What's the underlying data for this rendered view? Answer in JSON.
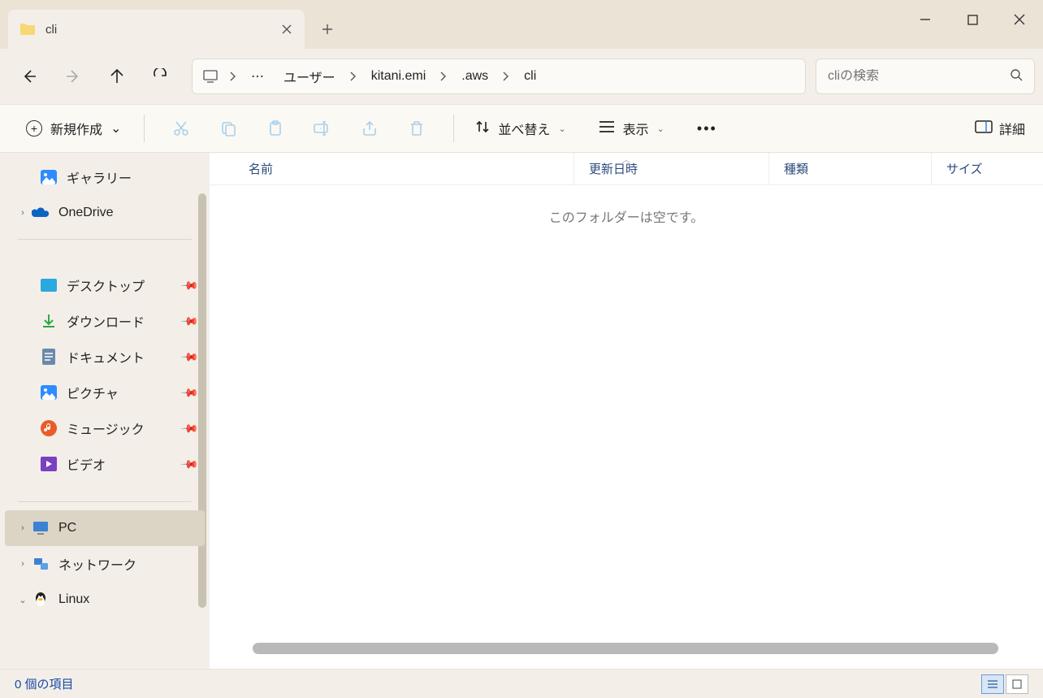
{
  "tab": {
    "title": "cli"
  },
  "breadcrumb": {
    "segments": [
      "ユーザー",
      "kitani.emi",
      ".aws",
      "cli"
    ]
  },
  "search": {
    "placeholder": "cliの検索"
  },
  "toolbar": {
    "new_label": "新規作成",
    "sort_label": "並べ替え",
    "view_label": "表示",
    "details_label": "詳細"
  },
  "sidebar": {
    "gallery": "ギャラリー",
    "onedrive": "OneDrive",
    "desktop": "デスクトップ",
    "downloads": "ダウンロード",
    "documents": "ドキュメント",
    "pictures": "ピクチャ",
    "music": "ミュージック",
    "videos": "ビデオ",
    "pc": "PC",
    "network": "ネットワーク",
    "linux": "Linux"
  },
  "columns": {
    "name": "名前",
    "date": "更新日時",
    "type": "種類",
    "size": "サイズ"
  },
  "content": {
    "empty_msg": "このフォルダーは空です。"
  },
  "status": {
    "text": "0 個の項目"
  }
}
